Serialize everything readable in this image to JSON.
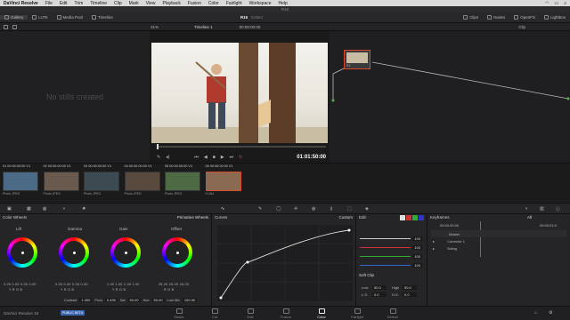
{
  "menubar": {
    "app": "DaVinci Resolve",
    "items": [
      "File",
      "Edit",
      "Trim",
      "Timeline",
      "Clip",
      "Mark",
      "View",
      "Playback",
      "Fusion",
      "Color",
      "Fairlight",
      "Workspace",
      "Help"
    ]
  },
  "window_title": "R16",
  "project": {
    "name": "R16",
    "status": "Edited"
  },
  "toolbar": {
    "gallery": "Gallery",
    "luts": "LUTs",
    "media_pool": "Media Pool",
    "timeline": "Timeline",
    "clips": "Clips",
    "nodes": "Nodes",
    "openfx": "OpenFX",
    "lightbox": "Lightbox"
  },
  "subbar": {
    "zoom": "31%",
    "timeline_name": "Timeline 1",
    "timecode": "00:00:00:00",
    "mode": "Clip"
  },
  "gallery": {
    "empty_text": "No stills created"
  },
  "viewer": {
    "timecode": "01:01:50:00"
  },
  "node": {
    "label": "01"
  },
  "clips": [
    {
      "num": "01",
      "tc": "00:00:00:00",
      "track": "V1",
      "caption": "Photo JPEG",
      "color": "#4a6a86"
    },
    {
      "num": "02",
      "tc": "00:00:00:00",
      "track": "V1",
      "caption": "Photo JPEG",
      "color": "#6a5a4e"
    },
    {
      "num": "03",
      "tc": "00:00:00:00",
      "track": "V1",
      "caption": "Photo JPEG",
      "color": "#3c4a52"
    },
    {
      "num": "04",
      "tc": "00:00:00:00",
      "track": "V1",
      "caption": "Photo JPEG",
      "color": "#5a4a3e"
    },
    {
      "num": "05",
      "tc": "00:00:00:00",
      "track": "V1",
      "caption": "Photo JPEG",
      "color": "#4e6a44"
    },
    {
      "num": "06",
      "tc": "00:00:00:00",
      "track": "V1",
      "caption": "H.264",
      "color": "#8a6a52"
    }
  ],
  "color_wheels": {
    "title": "Color Wheels",
    "mode": "Primaries Wheels",
    "wheels": [
      {
        "name": "Lift",
        "values": "0.00  0.00  0.00  0.00",
        "labels": "Y  R  G  B"
      },
      {
        "name": "Gamma",
        "values": "0.00  0.00  0.00  0.00",
        "labels": "Y  R  G  B"
      },
      {
        "name": "Gain",
        "values": "1.00  1.00  1.00  1.00",
        "labels": "Y  R  G  B"
      },
      {
        "name": "Offset",
        "values": "25.00  25.00  25.00",
        "labels": "R  G  B"
      }
    ],
    "footer": {
      "contrast_label": "Contrast",
      "contrast": "1.000",
      "pivot_label": "Pivot",
      "pivot": "0.435",
      "sat_label": "Sat",
      "sat": "50.00",
      "hue_label": "Hue",
      "hue": "50.00",
      "lummix_label": "Lum Mix",
      "lummix": "100.00"
    }
  },
  "curves": {
    "title": "Curves",
    "mode": "Custom"
  },
  "edit_panel": {
    "edit_label": "Edit",
    "values": [
      "100",
      "100",
      "100",
      "100"
    ],
    "soft_clip": "Soft Clip",
    "low_label": "Low",
    "low": "50.0",
    "high_label": "High",
    "high": "50.0",
    "ls_label": "L.S.",
    "ls": "0.0",
    "hs_label": "H.S.",
    "hs": "0.0"
  },
  "keyframes": {
    "title": "Keyframes",
    "filter": "All",
    "timecode": "00:00:00:00",
    "end_timecode": "00:00:01:0",
    "rows": [
      "Master",
      "Corrector 1",
      "Sizing"
    ]
  },
  "pages": [
    "Media",
    "Cut",
    "Edit",
    "Fusion",
    "Color",
    "Fairlight",
    "Deliver"
  ],
  "active_page": "Color",
  "footer": {
    "app_version": "DaVinci Resolve 16",
    "badge": "PUBLIC BETA"
  }
}
